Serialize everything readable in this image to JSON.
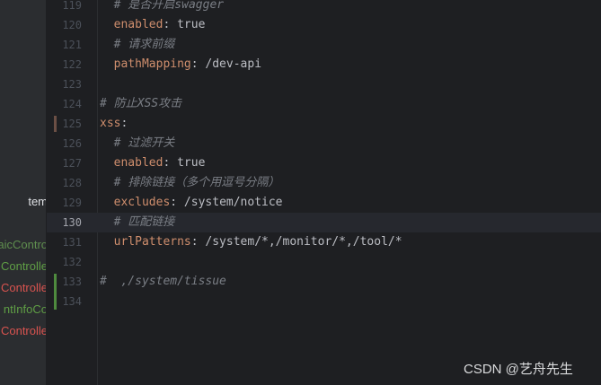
{
  "project_panel": {
    "items": [
      {
        "label": "tem",
        "color": "#dfe1e5"
      },
      {
        "label": "aicContro",
        "color": "#5f8f4e"
      },
      {
        "label": "Controlle",
        "color": "#5f9e45"
      },
      {
        "label": "Controlle",
        "color": "#d9534f"
      },
      {
        "label": "ntInfoCo",
        "color": "#5f9e45"
      },
      {
        "label": "Controlle",
        "color": "#d9534f"
      }
    ]
  },
  "editor": {
    "current_line": "130",
    "lines": [
      {
        "number": "119",
        "indent": "  ",
        "comment": "# 是否开启swagger"
      },
      {
        "number": "120",
        "indent": "  ",
        "key": "enabled",
        "value": ": true"
      },
      {
        "number": "121",
        "indent": "  ",
        "comment": "# 请求前缀"
      },
      {
        "number": "122",
        "indent": "  ",
        "key": "pathMapping",
        "value": ": /dev-api"
      },
      {
        "number": "123",
        "indent": ""
      },
      {
        "number": "124",
        "indent": "",
        "comment": "# 防止XSS攻击"
      },
      {
        "number": "125",
        "indent": "",
        "key": "xss",
        "value": ":"
      },
      {
        "number": "126",
        "indent": "  ",
        "comment": "# 过滤开关"
      },
      {
        "number": "127",
        "indent": "  ",
        "key": "enabled",
        "value": ": true"
      },
      {
        "number": "128",
        "indent": "  ",
        "comment": "# 排除链接（多个用逗号分隔）"
      },
      {
        "number": "129",
        "indent": "  ",
        "key": "excludes",
        "value": ": /system/notice"
      },
      {
        "number": "130",
        "indent": "  ",
        "comment": "# 匹配链接"
      },
      {
        "number": "131",
        "indent": "  ",
        "key": "urlPatterns",
        "value": ": /system/*,/monitor/*,/tool/*"
      },
      {
        "number": "132",
        "indent": ""
      },
      {
        "number": "133",
        "indent": "",
        "comment": "#  ,/system/tissue"
      },
      {
        "number": "134",
        "indent": ""
      }
    ],
    "change_markers": [
      {
        "line": "125",
        "color": "#6b4f45"
      },
      {
        "line": "133",
        "color": "#4e8a3e"
      }
    ]
  },
  "watermark": "CSDN @艺舟先生",
  "colors": {
    "background": "#1e1f22",
    "panel": "#2b2d30",
    "yaml_key": "#cf8e6d",
    "comment": "#7a7e85",
    "text": "#bcbec4",
    "line_number": "#4b5059",
    "current_line_bg": "#26282e"
  }
}
